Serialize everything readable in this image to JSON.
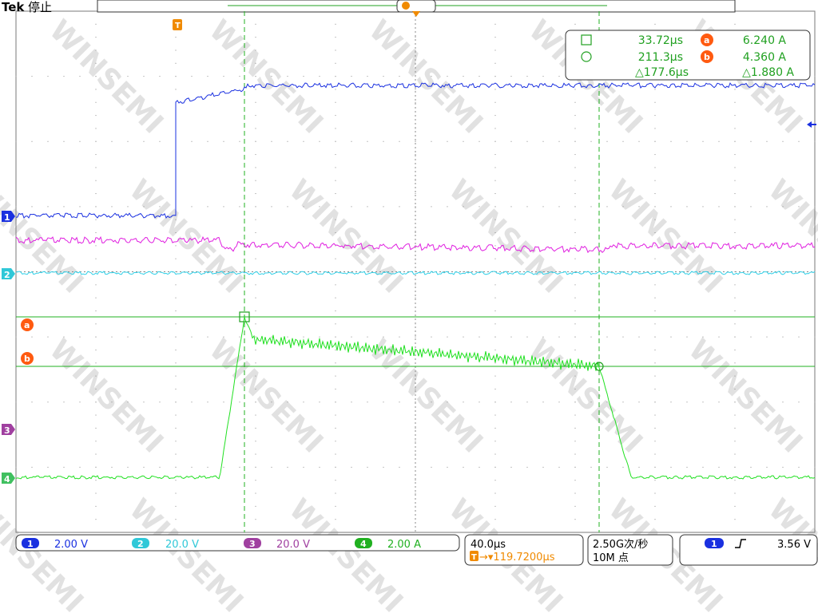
{
  "header": {
    "brand": "Tek",
    "status": "停止",
    "trigger_marker": "T"
  },
  "measurements": {
    "cursor1_time": "33.72µs",
    "cursor2_time": "211.3µs",
    "delta_time": "△177.6µs",
    "cursor_a_value": "6.240 A",
    "cursor_b_value": "4.360 A",
    "delta_value": "△1.880 A",
    "cursor_a_label": "a",
    "cursor_b_label": "b"
  },
  "channels": [
    {
      "num": "1",
      "scale": "2.00 V",
      "color": "#1030e0"
    },
    {
      "num": "2",
      "scale": "20.0 V",
      "color": "#30d0e8"
    },
    {
      "num": "3",
      "scale": "20.0 V",
      "color": "#e020e0"
    },
    {
      "num": "4",
      "scale": "2.00 A",
      "color": "#20e020"
    }
  ],
  "timebase": {
    "scale": "40.0µs",
    "trigger_pos_icon": "T",
    "trigger_position": "→▾119.7200µs"
  },
  "acquisition": {
    "sample_rate": "2.50G次/秒",
    "record_length": "10M 点"
  },
  "trigger": {
    "source": "1",
    "slope": "rising-edge",
    "level": "3.56 V"
  },
  "watermark": "WINSEMI",
  "colors": {
    "grid": "#8a8a8a",
    "cursor": "#20b020",
    "ref_marker": "#ff7a00",
    "accent_orange": "#f08a00"
  }
}
